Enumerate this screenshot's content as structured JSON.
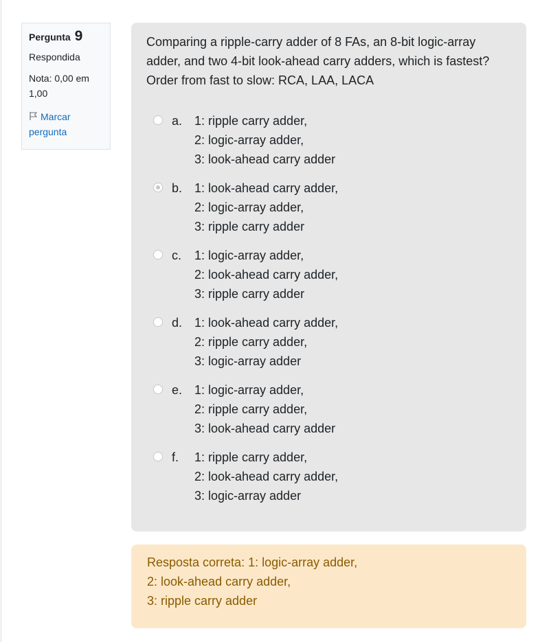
{
  "info": {
    "heading": "Pergunta",
    "number": "9",
    "state": "Respondida",
    "grade": "Nota: 0,00 em 1,00",
    "flag_label": "Marcar pergunta"
  },
  "question": {
    "text": "Comparing a ripple-carry adder of 8 FAs, an 8-bit logic-array adder, and two 4-bit look-ahead carry adders, which is fastest? Order from fast to slow: RCA, LAA, LACA"
  },
  "answers": [
    {
      "letter": "a.",
      "selected": false,
      "lines": [
        "1: ripple carry adder,",
        "2: logic-array adder,",
        "3: look-ahead carry adder"
      ]
    },
    {
      "letter": "b.",
      "selected": true,
      "lines": [
        "1: look-ahead carry adder,",
        "2: logic-array adder,",
        "3: ripple carry adder"
      ]
    },
    {
      "letter": "c.",
      "selected": false,
      "lines": [
        "1: logic-array adder,",
        "2: look-ahead carry adder,",
        "3: ripple carry adder"
      ]
    },
    {
      "letter": "d.",
      "selected": false,
      "lines": [
        "1: look-ahead carry adder,",
        "2: ripple carry adder,",
        "3: logic-array adder"
      ]
    },
    {
      "letter": "e.",
      "selected": false,
      "lines": [
        "1: logic-array adder,",
        "2: ripple carry adder,",
        "3: look-ahead carry adder"
      ]
    },
    {
      "letter": "f.",
      "selected": false,
      "lines": [
        "1: ripple carry adder,",
        "2: look-ahead carry adder,",
        "3: logic-array adder"
      ]
    }
  ],
  "feedback": {
    "lines": [
      "Resposta correta: 1: logic-array adder,",
      "2: look-ahead carry adder,",
      "3: ripple carry adder"
    ]
  },
  "colors": {
    "link": "#0f6cbf",
    "content_bg": "#e7e7e7",
    "feedback_bg": "#fce8c8",
    "feedback_text": "#8a5a00"
  }
}
